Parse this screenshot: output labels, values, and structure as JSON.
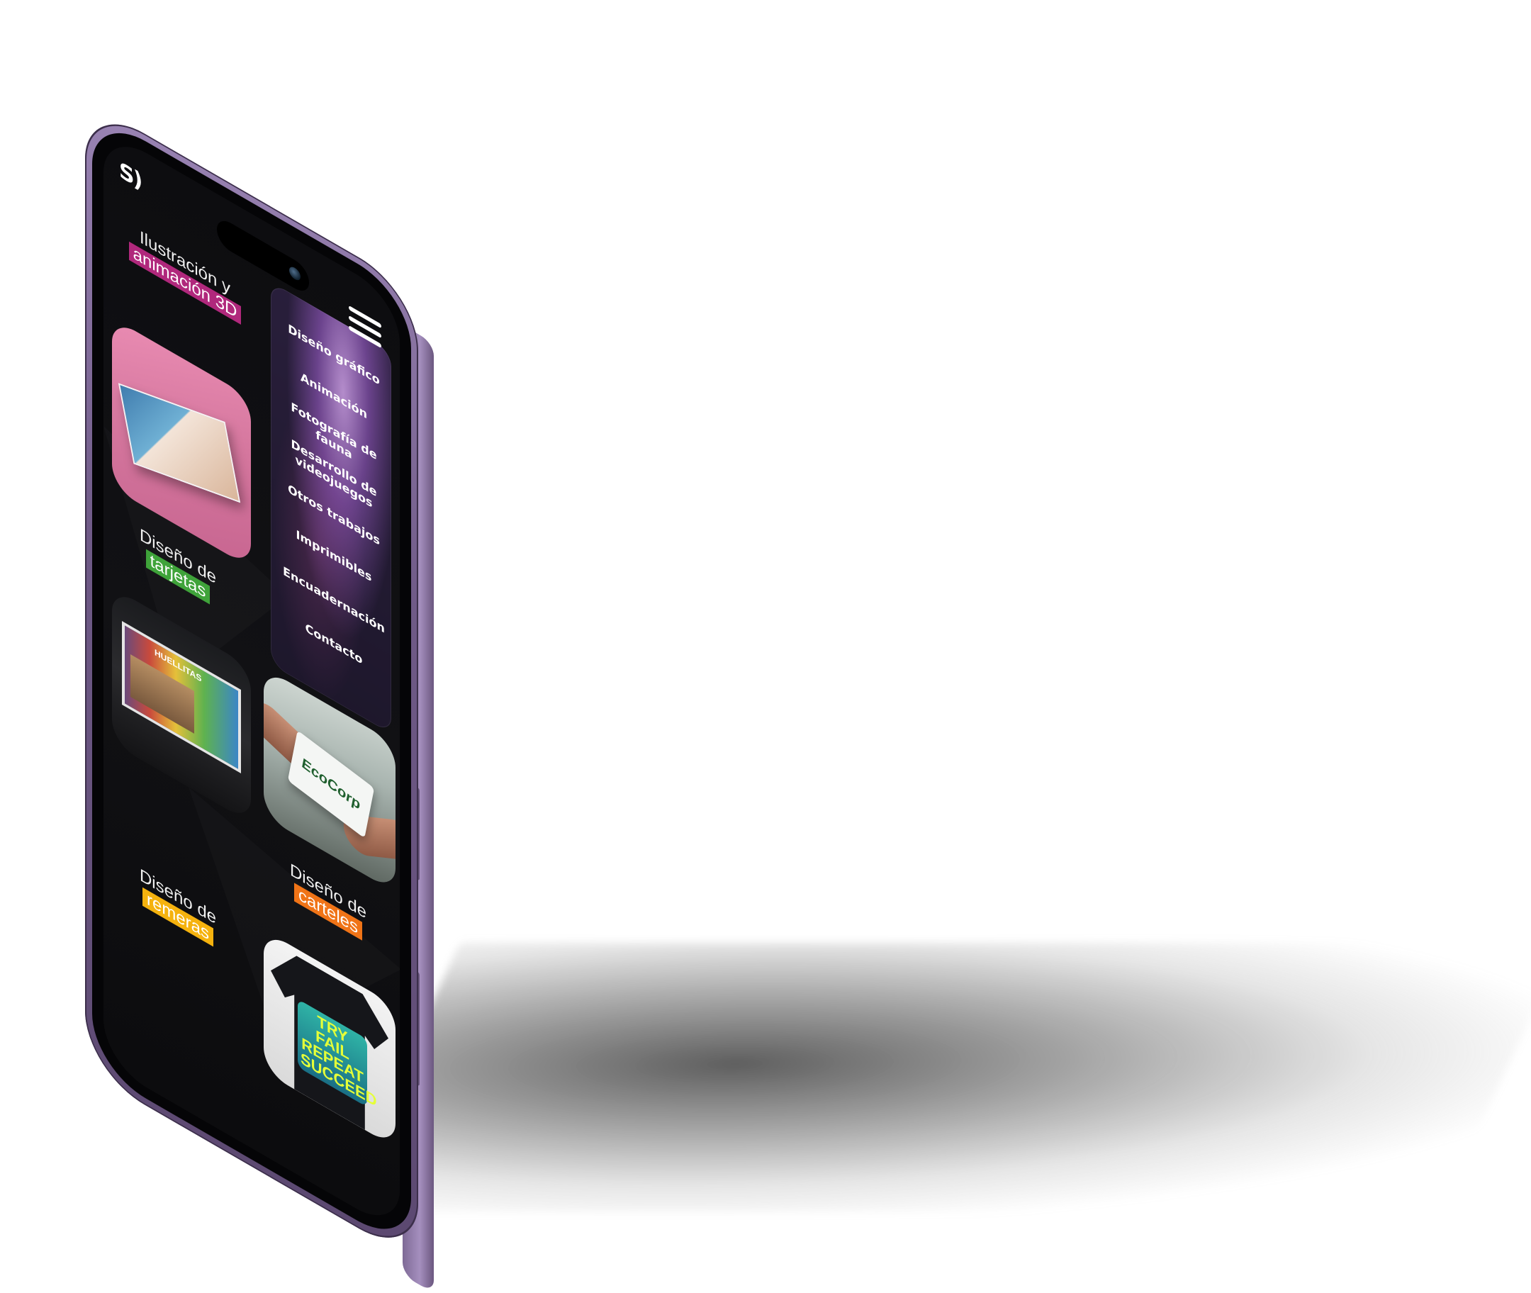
{
  "site": {
    "logo_text": "S)"
  },
  "menu": {
    "items": [
      {
        "label": "Diseño gráfico"
      },
      {
        "label": "Animación"
      },
      {
        "label": "Fotografía de fauna"
      },
      {
        "label": "Desarrollo de videojuegos"
      },
      {
        "label": "Otros trabajos"
      },
      {
        "label": "Imprimibles"
      },
      {
        "label": "Encuadernación"
      },
      {
        "label": "Contacto"
      }
    ]
  },
  "sections": [
    {
      "line1": "Ilustración y",
      "highlight": "animación 3D",
      "highlight_color": "#b0287c"
    },
    {
      "line1": "Diseño de",
      "highlight": "tarjetas",
      "highlight_color": "#3fa33a"
    },
    {
      "line1": "Diseño de",
      "highlight": "carteles",
      "highlight_color": "#f07417"
    },
    {
      "line1": "Diseño de",
      "highlight": "remeras",
      "highlight_color": "#f5b20e"
    }
  ],
  "images": {
    "business_card_brand": "EcoCorp",
    "billboard_text": "HUELLITAS",
    "shirt_text": "TRY FAIL REPEAT SUCCEED"
  },
  "colors": {
    "phone_frame": "#8d76a7",
    "screen_bg": "#0e0e11",
    "text": "#ffffff"
  }
}
